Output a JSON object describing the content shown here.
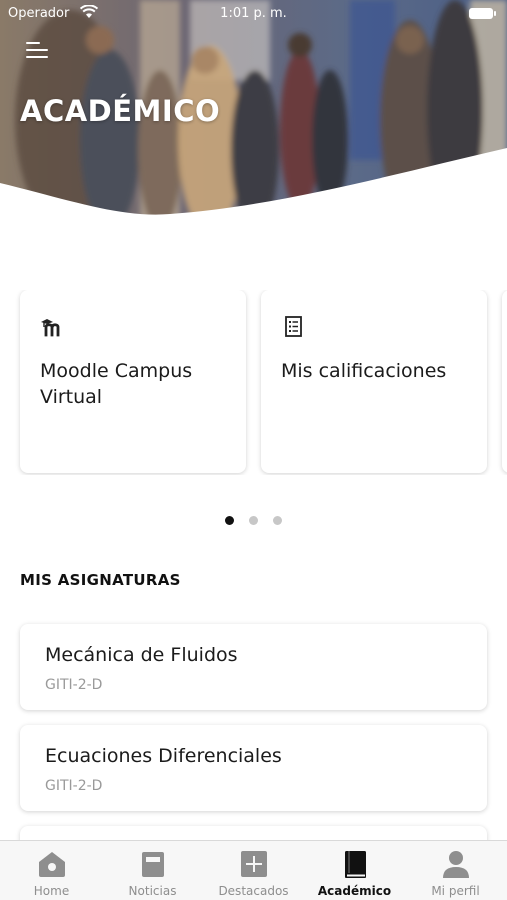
{
  "status_bar": {
    "carrier": "Operador",
    "time": "1:01 p. m."
  },
  "header": {
    "title": "ACADÉMICO"
  },
  "quick_links": [
    {
      "label": "Moodle Campus Virtual",
      "icon": "moodle-icon"
    },
    {
      "label": "Mis calificaciones",
      "icon": "grades-list-icon"
    }
  ],
  "pager": {
    "count": 3,
    "active": 0
  },
  "subjects_section": {
    "heading": "MIS ASIGNATURAS",
    "items": [
      {
        "name": "Mecánica de Fluidos",
        "group": "GITI-2-D"
      },
      {
        "name": "Ecuaciones Diferenciales",
        "group": "GITI-2-D"
      }
    ]
  },
  "tab_bar": {
    "active": "Académico",
    "tabs": [
      {
        "label": "Home",
        "icon": "home-icon"
      },
      {
        "label": "Noticias",
        "icon": "news-icon"
      },
      {
        "label": "Destacados",
        "icon": "plus-icon"
      },
      {
        "label": "Académico",
        "icon": "book-icon"
      },
      {
        "label": "Mi perfil",
        "icon": "profile-icon"
      }
    ]
  },
  "colors": {
    "active_tab": "#111111",
    "inactive_tab": "#8e8e8e",
    "subtitle": "#9a9a9a"
  }
}
